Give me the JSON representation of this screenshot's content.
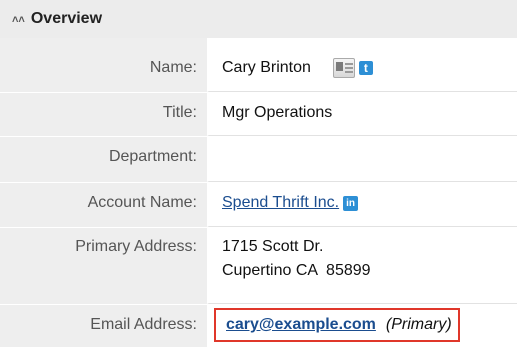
{
  "panel": {
    "title": "Overview"
  },
  "fields": {
    "name": {
      "label": "Name:",
      "value": "Cary Brinton"
    },
    "title": {
      "label": "Title:",
      "value": "Mgr Operations"
    },
    "department": {
      "label": "Department:",
      "value": ""
    },
    "account_name": {
      "label": "Account Name:",
      "value": "Spend Thrift Inc."
    },
    "primary_address": {
      "label": "Primary Address:",
      "line1": "1715 Scott Dr.",
      "line2": "Cupertino CA  85899"
    },
    "email": {
      "label": "Email Address:",
      "value": "cary@example.com",
      "tag": "(Primary)"
    }
  },
  "icons": {
    "collapse": "chevron-double-up-icon",
    "vcard": "vcard-icon",
    "twitter": "twitter-icon",
    "linkedin": "linkedin-icon",
    "twitter_glyph": "t",
    "linkedin_glyph": "in"
  },
  "colors": {
    "link": "#1b4d8f",
    "highlight_border": "#e0372a",
    "header_bg": "#ececec",
    "label_bg": "#eeeeee",
    "social_blue": "#2d8fd5"
  }
}
